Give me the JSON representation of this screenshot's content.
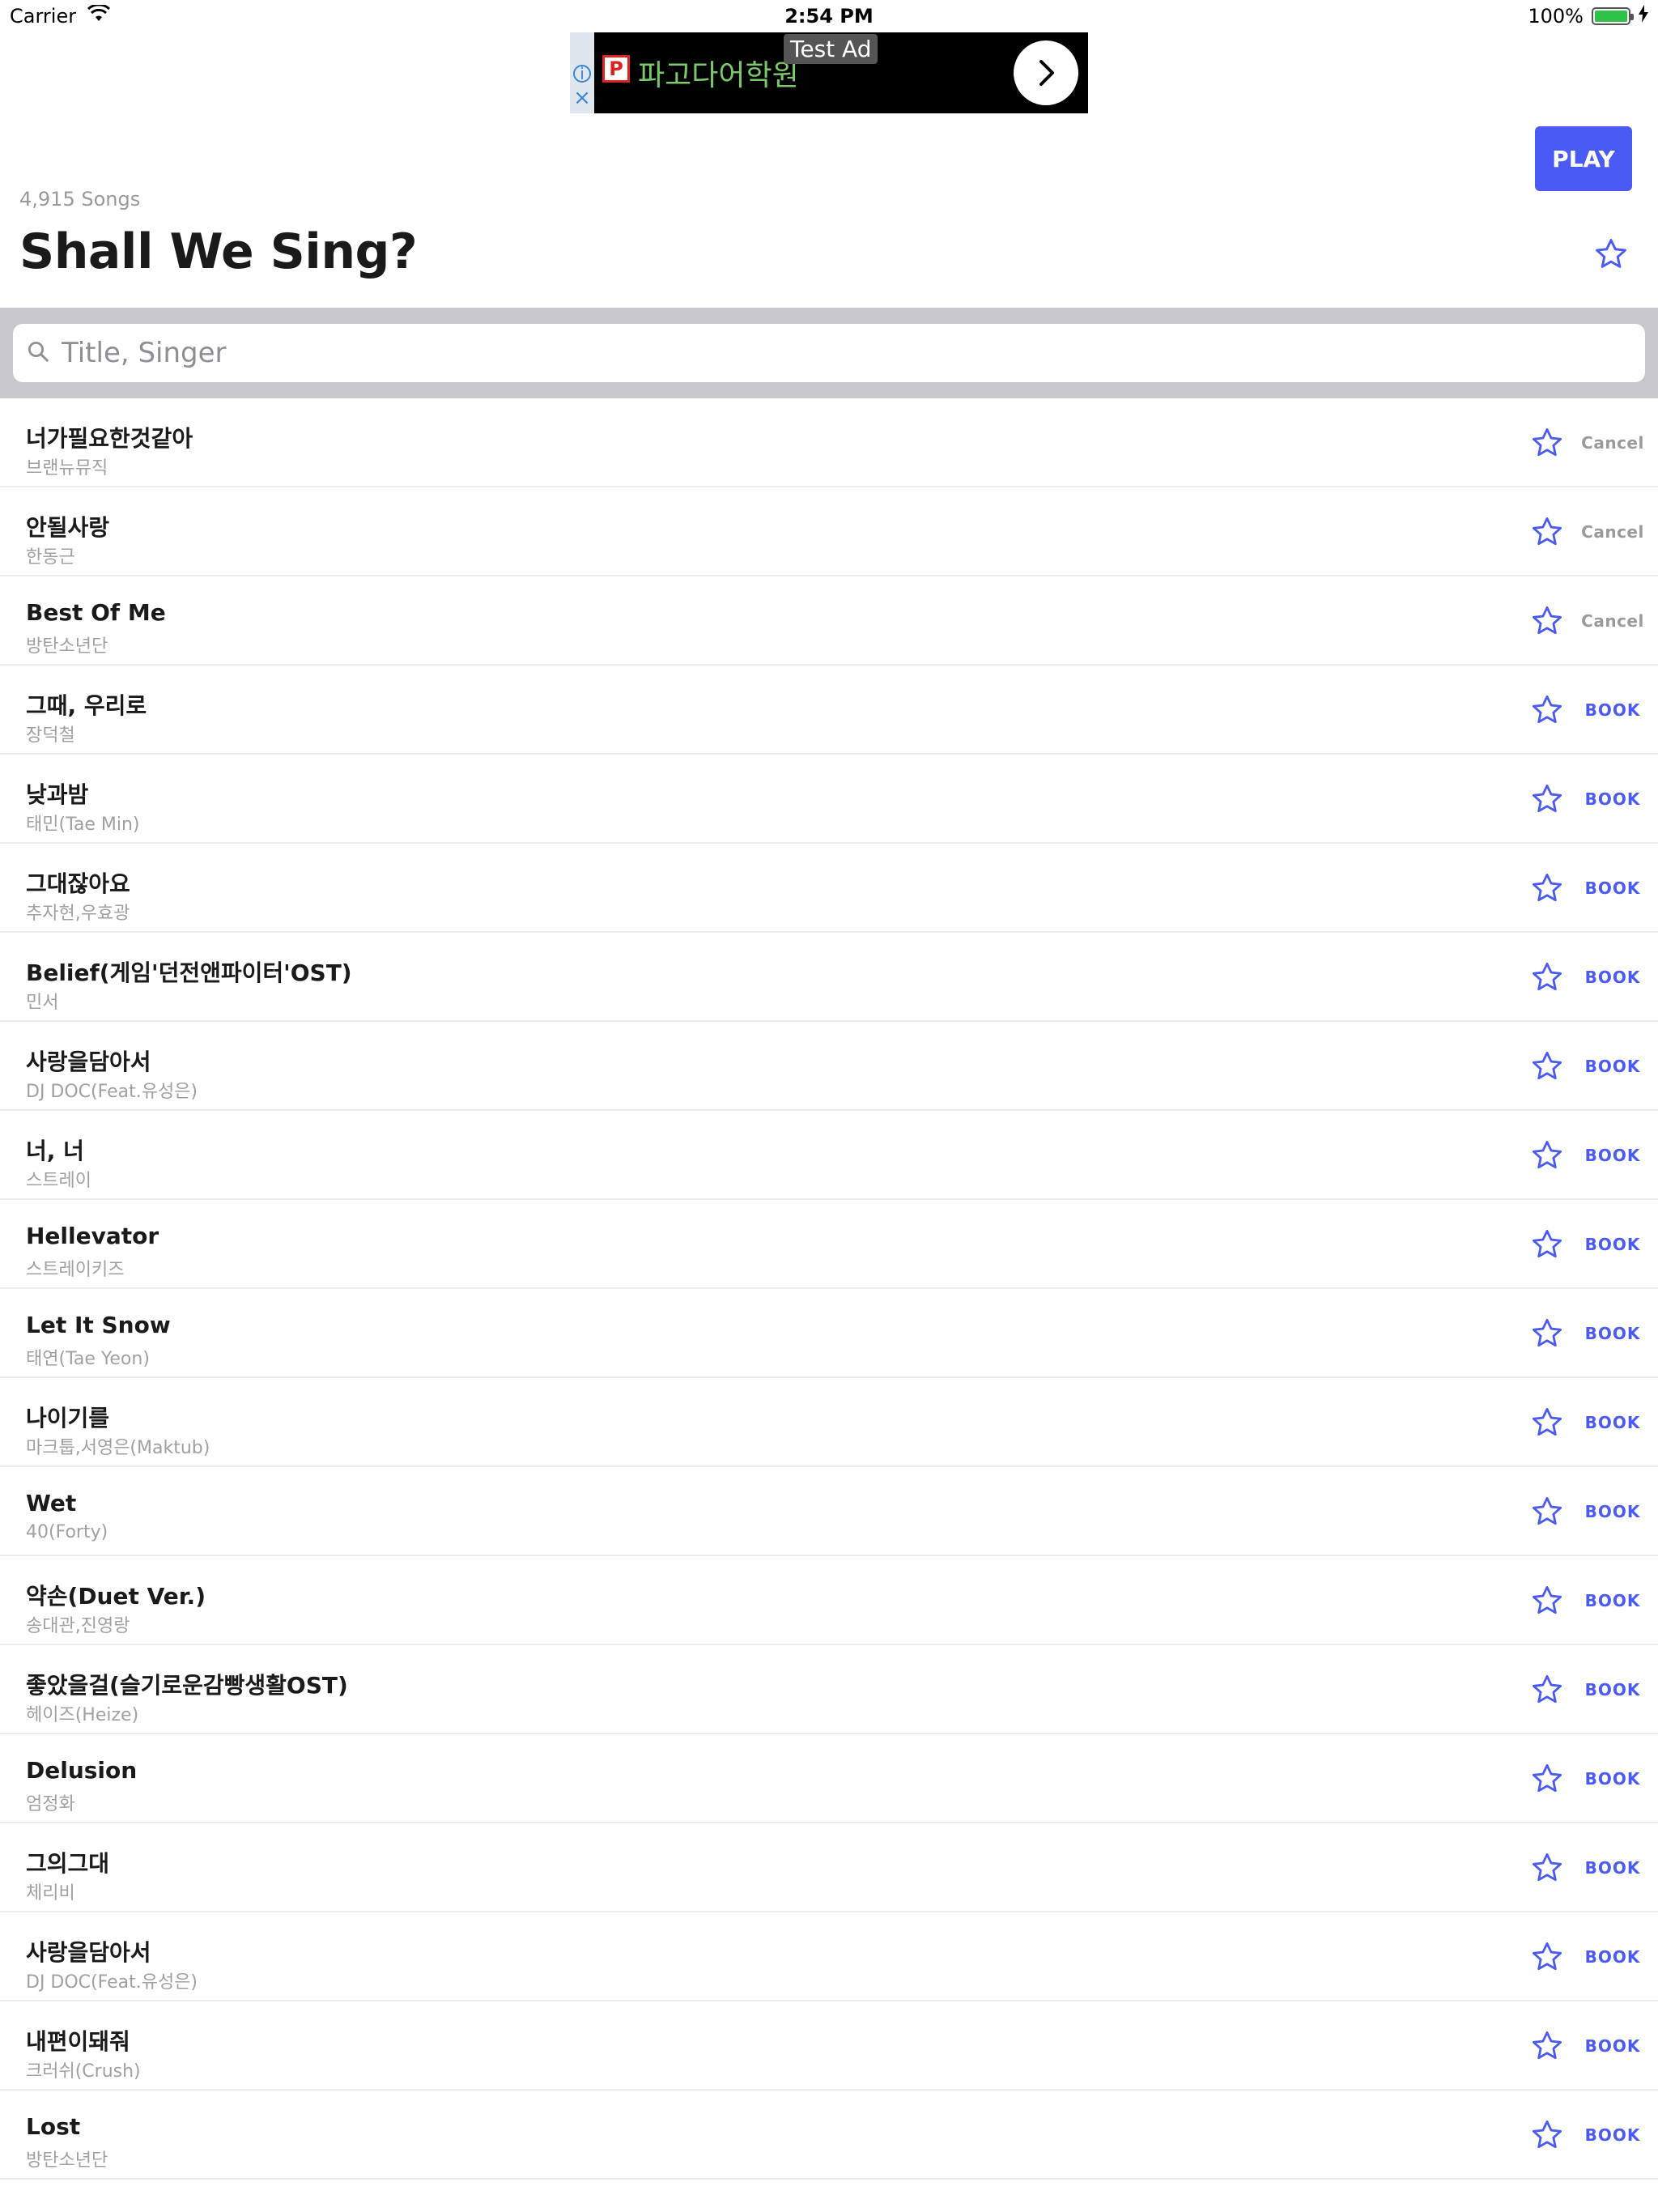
{
  "status_bar": {
    "carrier": "Carrier",
    "time": "2:54 PM",
    "battery_pct": "100%"
  },
  "ad": {
    "test_label": "Test Ad",
    "title": "파고다어학원",
    "logo_letter": "P"
  },
  "header": {
    "play_label": "PLAY",
    "song_count": "4,915 Songs",
    "title": "Shall We Sing?"
  },
  "search": {
    "placeholder": "Title, Singer"
  },
  "colors": {
    "accent": "#4a5af5",
    "muted": "#9a9a9a",
    "search_bg": "#c8c8cc"
  },
  "songs": [
    {
      "title": "너가필요한것같아",
      "artist": "브랜뉴뮤직",
      "action": "Cancel"
    },
    {
      "title": "안될사랑",
      "artist": "한동근",
      "action": "Cancel"
    },
    {
      "title": "Best Of Me",
      "artist": "방탄소년단",
      "action": "Cancel"
    },
    {
      "title": "그때, 우리로",
      "artist": "장덕철",
      "action": "BOOK"
    },
    {
      "title": "낮과밤",
      "artist": "태민(Tae Min)",
      "action": "BOOK"
    },
    {
      "title": "그대잖아요",
      "artist": "추자현,우효광",
      "action": "BOOK"
    },
    {
      "title": "Belief(게임'던전앤파이터'OST)",
      "artist": "민서",
      "action": "BOOK"
    },
    {
      "title": "사랑을담아서",
      "artist": "DJ DOC(Feat.유성은)",
      "action": "BOOK"
    },
    {
      "title": "너, 너",
      "artist": "스트레이",
      "action": "BOOK"
    },
    {
      "title": "Hellevator",
      "artist": "스트레이키즈",
      "action": "BOOK"
    },
    {
      "title": "Let It Snow",
      "artist": "태연(Tae Yeon)",
      "action": "BOOK"
    },
    {
      "title": "나이기를",
      "artist": "마크툽,서영은(Maktub)",
      "action": "BOOK"
    },
    {
      "title": "Wet",
      "artist": "40(Forty)",
      "action": "BOOK"
    },
    {
      "title": "약손(Duet Ver.)",
      "artist": "송대관,진영랑",
      "action": "BOOK"
    },
    {
      "title": "좋았을걸(슬기로운감빵생활OST)",
      "artist": "헤이즈(Heize)",
      "action": "BOOK"
    },
    {
      "title": "Delusion",
      "artist": "엄정화",
      "action": "BOOK"
    },
    {
      "title": "그의그대",
      "artist": "체리비",
      "action": "BOOK"
    },
    {
      "title": "사랑을담아서",
      "artist": "DJ DOC(Feat.유성은)",
      "action": "BOOK"
    },
    {
      "title": "내편이돼줘",
      "artist": "크러쉬(Crush)",
      "action": "BOOK"
    },
    {
      "title": "Lost",
      "artist": "방탄소년단",
      "action": "BOOK"
    }
  ]
}
